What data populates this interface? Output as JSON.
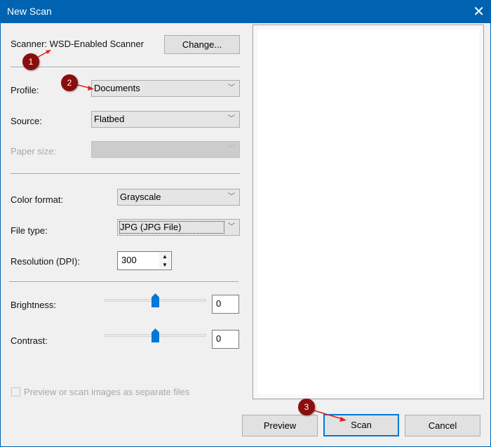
{
  "window": {
    "title": "New Scan"
  },
  "scanner": {
    "label": "Scanner: WSD-Enabled Scanner",
    "change_button": "Change..."
  },
  "profile": {
    "label": "Profile:",
    "value": "Documents"
  },
  "source": {
    "label": "Source:",
    "value": "Flatbed"
  },
  "paper_size": {
    "label": "Paper size:",
    "value": ""
  },
  "color_format": {
    "label": "Color format:",
    "value": "Grayscale"
  },
  "file_type": {
    "label": "File type:",
    "value": "JPG (JPG File)"
  },
  "resolution": {
    "label": "Resolution (DPI):",
    "value": "300"
  },
  "brightness": {
    "label": "Brightness:",
    "value": "0",
    "slider_percent": 50
  },
  "contrast": {
    "label": "Contrast:",
    "value": "0",
    "slider_percent": 50
  },
  "separate_files": {
    "label": "Preview or scan images as separate files",
    "checked": false
  },
  "buttons": {
    "preview": "Preview",
    "scan": "Scan",
    "cancel": "Cancel"
  },
  "markers": [
    "1",
    "2",
    "3"
  ],
  "colors": {
    "titlebar": "#0063b1",
    "accent": "#0078d7",
    "marker": "#8b0d0d"
  }
}
